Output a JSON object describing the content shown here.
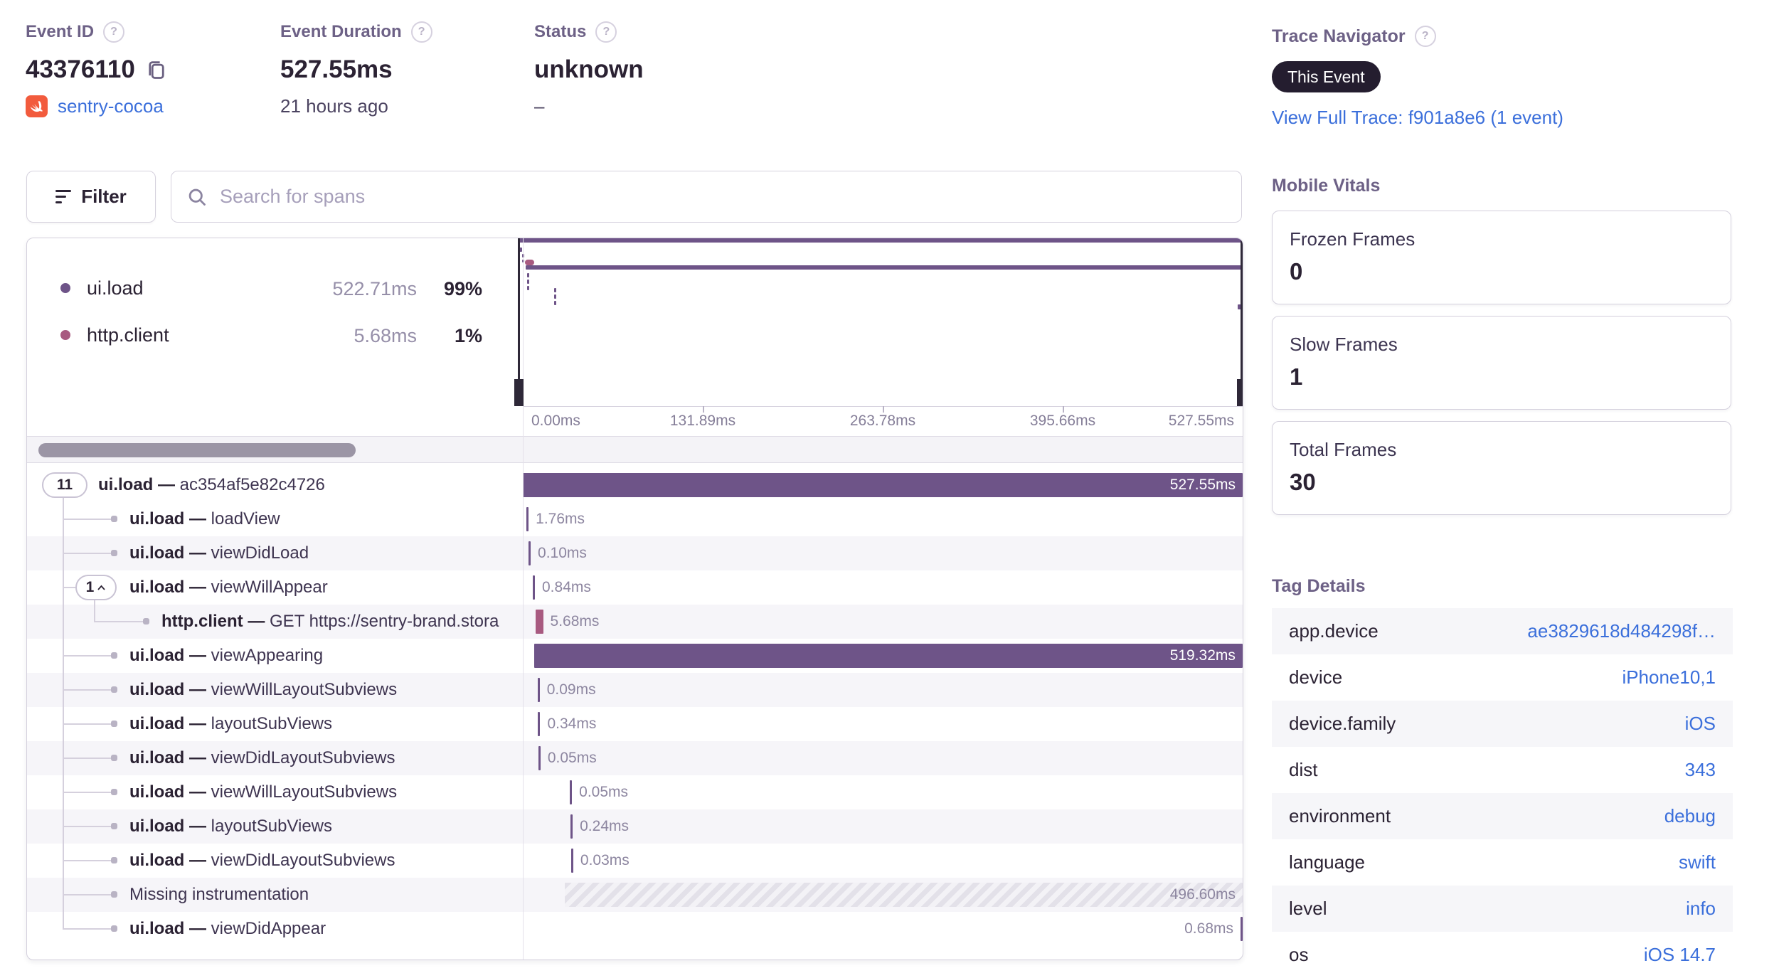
{
  "header": {
    "event_id": {
      "label": "Event ID",
      "value": "43376110",
      "project": "sentry-cocoa"
    },
    "event_duration": {
      "label": "Event Duration",
      "value": "527.55ms",
      "time_ago": "21 hours ago"
    },
    "status": {
      "label": "Status",
      "value": "unknown",
      "sub": "–"
    }
  },
  "toolbar": {
    "filter_label": "Filter",
    "search_placeholder": "Search for spans"
  },
  "trace_navigator": {
    "title": "Trace Navigator",
    "badge": "This Event",
    "link": "View Full Trace: f901a8e6 (1 event)"
  },
  "mobile_vitals": {
    "title": "Mobile Vitals",
    "cards": [
      {
        "label": "Frozen Frames",
        "value": "0"
      },
      {
        "label": "Slow Frames",
        "value": "1"
      },
      {
        "label": "Total Frames",
        "value": "30"
      }
    ]
  },
  "tag_details": {
    "title": "Tag Details",
    "rows": [
      {
        "key": "app.device",
        "value": "ae3829618d484298f…"
      },
      {
        "key": "device",
        "value": "iPhone10,1"
      },
      {
        "key": "device.family",
        "value": "iOS"
      },
      {
        "key": "dist",
        "value": "343"
      },
      {
        "key": "environment",
        "value": "debug"
      },
      {
        "key": "language",
        "value": "swift"
      },
      {
        "key": "level",
        "value": "info"
      },
      {
        "key": "os",
        "value": "iOS 14.7"
      }
    ]
  },
  "legend": {
    "items": [
      {
        "name": "ui.load",
        "duration": "522.71ms",
        "percent": "99%",
        "color": "#6e5488"
      },
      {
        "name": "http.client",
        "duration": "5.68ms",
        "percent": "1%",
        "color": "#a85a80"
      }
    ]
  },
  "minimap": {
    "axis_labels": [
      "0.00ms",
      "131.89ms",
      "263.78ms",
      "395.66ms",
      "527.55ms"
    ],
    "total_ms": 527.55
  },
  "span_tree": {
    "total_ms": 527.55,
    "rows": [
      {
        "pill": "11",
        "op": "ui.load",
        "name": "ac354af5e82c4726",
        "start_ms": 0,
        "duration_ms": 527.55,
        "duration_label": "527.55ms",
        "label_pos": "in",
        "kind": "ui",
        "depth": 0
      },
      {
        "op": "ui.load",
        "name": "loadView",
        "start_ms": 2.5,
        "duration_ms": 1.76,
        "duration_label": "1.76ms",
        "label_pos": "after",
        "kind": "ui",
        "depth": 1
      },
      {
        "op": "ui.load",
        "name": "viewDidLoad",
        "start_ms": 4.2,
        "duration_ms": 0.1,
        "duration_label": "0.10ms",
        "label_pos": "after",
        "kind": "ui",
        "depth": 1
      },
      {
        "pill": "1",
        "pill_caret": true,
        "op": "ui.load",
        "name": "viewWillAppear",
        "start_ms": 7.3,
        "duration_ms": 0.84,
        "duration_label": "0.84ms",
        "label_pos": "after",
        "kind": "ui",
        "depth": 1
      },
      {
        "op": "http.client",
        "name": "GET https://sentry-brand.stora",
        "start_ms": 9.2,
        "duration_ms": 5.68,
        "duration_label": "5.68ms",
        "label_pos": "after",
        "kind": "http",
        "depth": 2
      },
      {
        "op": "ui.load",
        "name": "viewAppearing",
        "start_ms": 8.2,
        "duration_ms": 519.32,
        "duration_label": "519.32ms",
        "label_pos": "in",
        "kind": "ui",
        "depth": 1
      },
      {
        "op": "ui.load",
        "name": "viewWillLayoutSubviews",
        "start_ms": 10.8,
        "duration_ms": 0.09,
        "duration_label": "0.09ms",
        "label_pos": "after",
        "kind": "ui",
        "depth": 1
      },
      {
        "op": "ui.load",
        "name": "layoutSubViews",
        "start_ms": 11.2,
        "duration_ms": 0.34,
        "duration_label": "0.34ms",
        "label_pos": "after",
        "kind": "ui",
        "depth": 1
      },
      {
        "op": "ui.load",
        "name": "viewDidLayoutSubviews",
        "start_ms": 11.4,
        "duration_ms": 0.05,
        "duration_label": "0.05ms",
        "label_pos": "after",
        "kind": "ui",
        "depth": 1
      },
      {
        "op": "ui.load",
        "name": "viewWillLayoutSubviews",
        "start_ms": 34.5,
        "duration_ms": 0.05,
        "duration_label": "0.05ms",
        "label_pos": "after",
        "kind": "ui",
        "depth": 1
      },
      {
        "op": "ui.load",
        "name": "layoutSubViews",
        "start_ms": 35.0,
        "duration_ms": 0.24,
        "duration_label": "0.24ms",
        "label_pos": "after",
        "kind": "ui",
        "depth": 1
      },
      {
        "op": "ui.load",
        "name": "viewDidLayoutSubviews",
        "start_ms": 35.4,
        "duration_ms": 0.03,
        "duration_label": "0.03ms",
        "label_pos": "after",
        "kind": "ui",
        "depth": 1
      },
      {
        "name": "Missing instrumentation",
        "start_ms": 30.95,
        "duration_ms": 496.6,
        "duration_label": "496.60ms",
        "label_pos": "in",
        "kind": "missing",
        "depth": 1
      },
      {
        "op": "ui.load",
        "name": "viewDidAppear",
        "start_ms": 526.87,
        "duration_ms": 0.68,
        "duration_label": "0.68ms",
        "label_pos": "before",
        "kind": "ui",
        "depth": 1
      }
    ]
  },
  "colors": {
    "ui_span": "#6e5488",
    "http_span": "#a85a80",
    "link_blue": "#3b6fdb",
    "badge_bg": "#241d2f",
    "swift_orange": "#f25b3d"
  }
}
